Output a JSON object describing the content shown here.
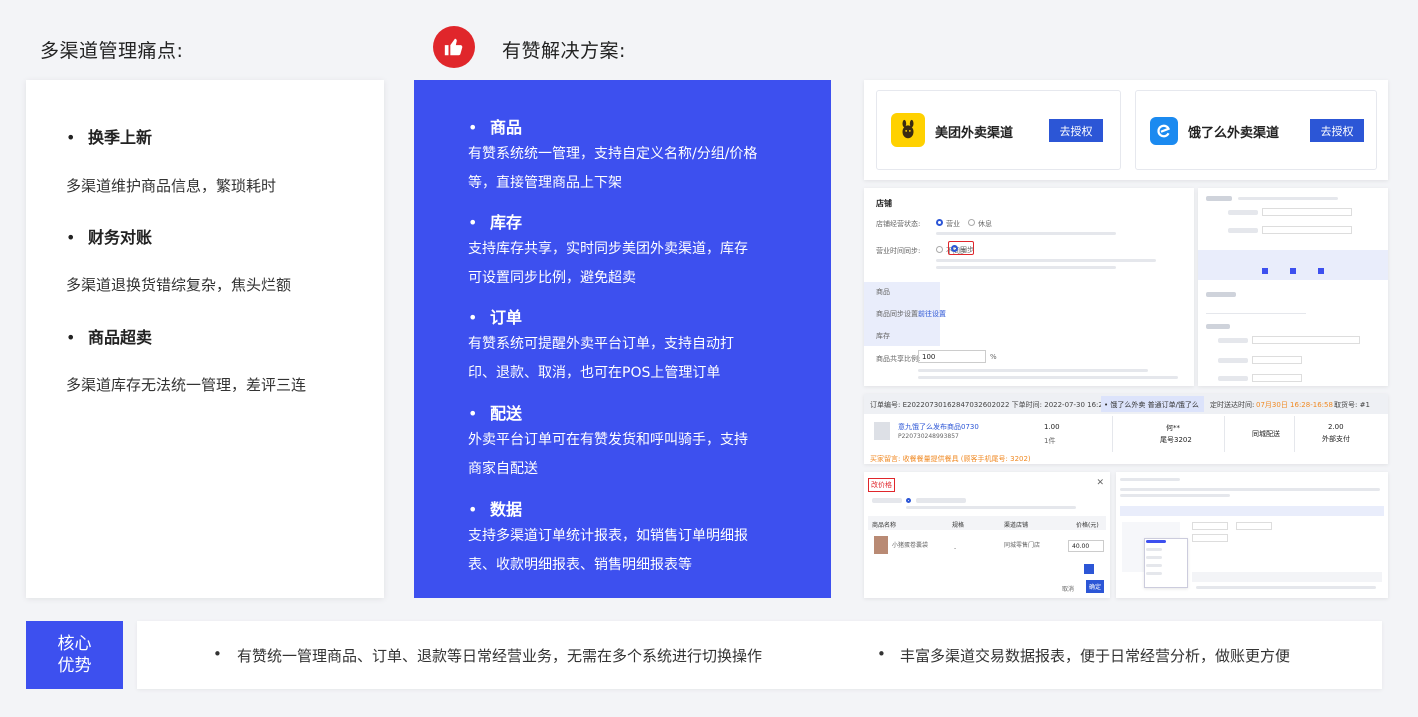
{
  "header": {
    "left_title": "多渠道管理痛点:",
    "right_title": "有赞解决方案:"
  },
  "pain_points": [
    {
      "title": "换季上新",
      "desc": "多渠道维护商品信息，繁琐耗时"
    },
    {
      "title": "财务对账",
      "desc": "多渠道退换货错综复杂，焦头烂额"
    },
    {
      "title": "商品超卖",
      "desc": "多渠道库存无法统一管理，差评三连"
    }
  ],
  "solutions": [
    {
      "title": "商品",
      "lines": [
        "有赞系统统一管理，支持自定义名称/分组/价格",
        "等，直接管理商品上下架"
      ]
    },
    {
      "title": "库存",
      "lines": [
        "支持库存共享，实时同步美团外卖渠道，库存",
        "可设置同步比例，避免超卖"
      ]
    },
    {
      "title": "订单",
      "lines": [
        "有赞系统可提醒外卖平台订单，支持自动打",
        "印、退款、取消，也可在POS上管理订单"
      ]
    },
    {
      "title": "配送",
      "lines": [
        "外卖平台订单可在有赞发货和呼叫骑手，支持",
        "商家自配送"
      ]
    },
    {
      "title": "数据",
      "lines": [
        "支持多渠道订单统计报表，如销售订单明细报",
        "表、收款明细报表、销售明细报表等"
      ]
    }
  ],
  "screenshots": {
    "channels": [
      {
        "name": "美团外卖渠道",
        "button": "去授权",
        "icon": "meituan-kangaroo-icon"
      },
      {
        "name": "饿了么外卖渠道",
        "button": "去授权",
        "icon": "eleme-icon"
      }
    ],
    "store_panel": {
      "title": "店铺",
      "status_label": "店铺经营状态:",
      "status_opt1": "营业",
      "status_opt2": "休息",
      "sync_label": "营业时间同步:",
      "sync_opt1": "不同步",
      "sync_opt2": "同步",
      "goods_section": "商品",
      "goods_sync_label": "商品同步设置:",
      "goods_sync_link": "前往设置",
      "stock_section": "库存",
      "stock_ratio_label": "商品共享比例:",
      "stock_ratio_value": "100",
      "stock_ratio_unit": "%"
    },
    "order_bar": {
      "text": "订单编号: E20220730162847032602022  下单时间: 2022-07-30 16:28:39",
      "channel": "• 饿了么外卖  普通订单/饿了么",
      "delivery_label": "定时送达时间:",
      "delivery_time": "07月30日 16:28-16:58",
      "pickup": "取货号: #1"
    },
    "order_row": {
      "product": "意九饿了么发布商品0730",
      "sku": "P220730248993857",
      "price": "1.00",
      "qty": "1件",
      "customer": "何**",
      "tail": "尾号3202",
      "delivery": "同城配送",
      "amount": "2.00",
      "pay": "外部支付",
      "note": "买家留言: 收餐餐量提供餐具 (顾客手机尾号: 3202)"
    },
    "price_dialog": {
      "tag": "改价格",
      "col1": "商品名称",
      "col2": "规格",
      "col3": "渠道店铺",
      "col4": "价格(元)",
      "item": "小猪蛋卷囊袋",
      "spec": "-",
      "store": "同城零售门店",
      "price": "40.00",
      "cancel": "取消",
      "ok": "确定"
    }
  },
  "core": {
    "label_line1": "核心",
    "label_line2": "优势",
    "points": [
      "有赞统一管理商品、订单、退款等日常经营业务，无需在多个系统进行切换操作",
      "丰富多渠道交易数据报表，便于日常经营分析，做账更方便"
    ]
  },
  "colors": {
    "accent_blue": "#3d50ef",
    "red": "#e0262b",
    "orange": "#f08a24",
    "button_blue": "#2c56d6"
  }
}
